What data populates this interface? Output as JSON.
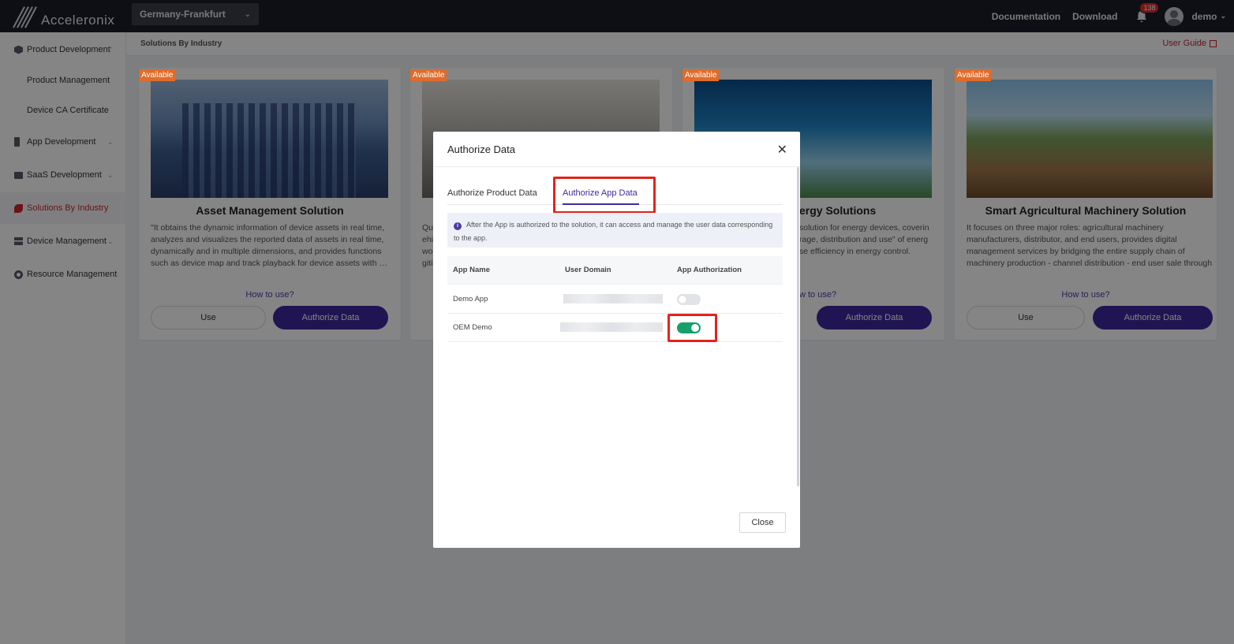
{
  "app": {
    "logo_text": "Acceleronix"
  },
  "header": {
    "region": "Germany-Frankfurt",
    "documentation": "Documentation",
    "download": "Download",
    "notification_count": "138",
    "user": "demo"
  },
  "sidebar": {
    "items": [
      {
        "label": "Product Development",
        "icon": "hexagon-icon"
      },
      {
        "label": "Product Management"
      },
      {
        "label": "Device CA Certificate"
      },
      {
        "label": "App Development",
        "icon": "phone-icon"
      },
      {
        "label": "SaaS Development",
        "icon": "monitor-icon"
      },
      {
        "label": "Solutions By Industry",
        "icon": "leaf-icon"
      },
      {
        "label": "Device Management",
        "icon": "server-icon"
      },
      {
        "label": "Resource Management",
        "icon": "gear-icon"
      }
    ]
  },
  "page": {
    "breadcrumb": "Solutions By Industry",
    "user_guide": "User Guide"
  },
  "cards": [
    {
      "badge": "Available",
      "title": "Asset Management Solution",
      "desc": "\"It obtains the dynamic information of device assets in real time, analyzes and visualizes the reported data of assets in real time, dynamically and in multiple dimensions, and provides functions such as device map and track playback for device assets with …",
      "how_to": "How to use?",
      "use_label": "Use",
      "auth_label": "Authorize Data"
    },
    {
      "badge": "Available",
      "title": "",
      "desc": "Qu ehi wo giti",
      "how_to": "",
      "use_label": "",
      "auth_label": ""
    },
    {
      "badge": "Available",
      "title": "ergy Solutions",
      "desc": "solution for energy devices, coverin rage, distribution and use\" of energ se efficiency in energy control.",
      "how_to": "w to use?",
      "use_label": "",
      "auth_label": "Authorize Data"
    },
    {
      "badge": "Available",
      "title": "Smart Agricultural Machinery Solution",
      "desc": "It focuses on three major roles: agricultural machinery manufacturers, distributor, and end users, provides digital management services by bridging the entire supply chain of machinery production - channel distribution - end user sale through integrating three key mo…",
      "how_to": "How to use?",
      "use_label": "Use",
      "auth_label": "Authorize Data"
    }
  ],
  "modal": {
    "title": "Authorize Data",
    "tabs": [
      "Authorize Product Data",
      "Authorize App Data"
    ],
    "active_tab": "Authorize App Data",
    "notice": "After the App is authorized to the solution, it can access and manage the user data corresponding to the app.",
    "columns": [
      "App Name",
      "User Domain",
      "App Authorization"
    ],
    "rows": [
      {
        "app_name": "Demo App",
        "authorized": false
      },
      {
        "app_name": "OEM Demo",
        "authorized": true
      }
    ],
    "close_label": "Close"
  },
  "colors": {
    "accent": "#3e2a9e",
    "highlight": "#e3231b",
    "switch_on": "#16a06a",
    "badge": "#e06b2a"
  }
}
